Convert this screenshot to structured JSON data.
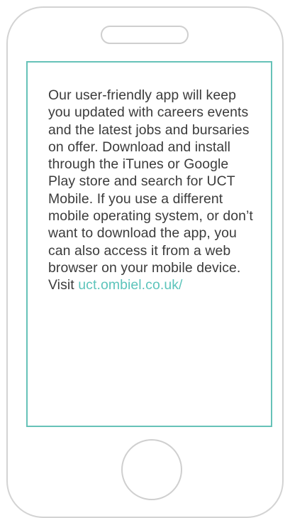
{
  "screen": {
    "body_text": "Our user-friendly app will keep you updated with careers events and the latest jobs and bursaries on offer. Download and install through the iTunes or Google Play store and search for UCT Mobile. If you use a different mobile operating system, or don’t want to download the app, you can also access it from a web browser on your mobile device. Visit",
    "link_text": "uct.ombiel.co.uk/"
  },
  "colors": {
    "screen_border": "#66c2b8",
    "link": "#5cc4bb",
    "phone_outline": "#d3d3d3",
    "text": "#3b3b3b"
  }
}
